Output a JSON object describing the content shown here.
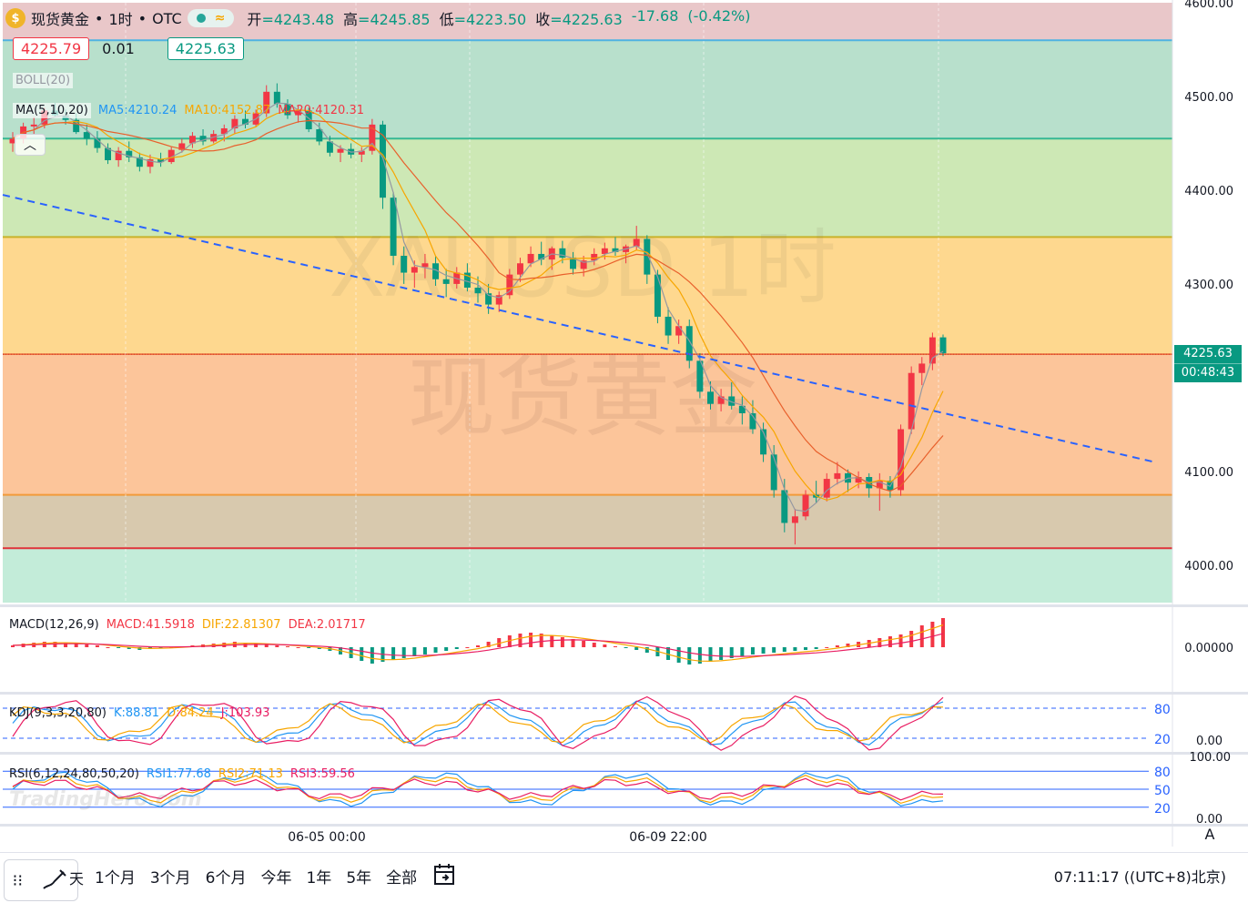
{
  "header": {
    "symbol": "现货黄金",
    "interval": "1时",
    "exchange": "OTC",
    "coin_glyph": "$",
    "wave_glyph": "≈",
    "open_label": "开",
    "open": "=4243.48",
    "high_label": "高",
    "high": "=4245.85",
    "low_label": "低",
    "low": "=4223.50",
    "close_label": "收",
    "close": "=4225.63",
    "change": "-17.68",
    "change_pct": "(-0.42%)"
  },
  "quote": {
    "sell": "4225.79",
    "spread": "0.01",
    "buy": "4225.63"
  },
  "legends": {
    "boll": "BOLL(20)",
    "ma_title": "MA(5,10,20)",
    "ma5": "MA5:4210.24",
    "ma10": "MA10:4152.87",
    "ma20": "MA20:4120.31",
    "macd_title": "MACD(12,26,9)",
    "macd": "MACD:41.5918",
    "dif": "DIF:22.81307",
    "dea": "DEA:2.01717",
    "kdj_title": "KDJ(9,3,3,20,80)",
    "k": "K:88.81",
    "d": "D:84.24",
    "j": "J:103.93",
    "rsi_title": "RSI(6,12,24,80,50,20)",
    "rsi1": "RSI1:77.68",
    "rsi2": "RSI2:71.13",
    "rsi3": "RSI3:59.56"
  },
  "watermark": {
    "line1": "XAUUSD 1时",
    "line2": "现货黄金",
    "brand": "TradingHero.com"
  },
  "price_tag": {
    "price": "4225.63",
    "countdown": "00:48:43"
  },
  "bottom": {
    "ranges": [
      "1个月",
      "3个月",
      "6个月",
      "今年",
      "1年",
      "5年",
      "全部"
    ],
    "clock": "07:11:17 ((UTC+8)北京)",
    "auto_label": "A",
    "grip_glyph": "⁝⁝",
    "cut_glyph": "天"
  },
  "colors": {
    "up": "#f23645",
    "down": "#089981",
    "ma5": "#9598a1",
    "ma10": "#f7a600",
    "ma20": "#e8602c",
    "trendline": "#2962ff",
    "macd_label": "#f23645",
    "dif": "#f7a600",
    "dea": "#e91e63",
    "k": "#2196f3",
    "d": "#f7a600",
    "j": "#e91e63"
  },
  "chart_data": {
    "type": "candlestick",
    "title": "现货黄金 · 1时 · OTC",
    "y_axis": {
      "ticks": [
        4000.0,
        4100.0,
        4200.0,
        4300.0,
        4400.0,
        4500.0,
        4600.0
      ],
      "range": [
        3960,
        4600
      ]
    },
    "x_axis": {
      "ticks": [
        "06-05 00:00",
        "06-09 22:00"
      ]
    },
    "ohlc_samples": [
      [
        4450,
        4462,
        4441,
        4455
      ],
      [
        4455,
        4472,
        4450,
        4468
      ],
      [
        4468,
        4478,
        4460,
        4470
      ],
      [
        4470,
        4488,
        4466,
        4485
      ],
      [
        4485,
        4493,
        4478,
        4480
      ],
      [
        4480,
        4486,
        4470,
        4475
      ],
      [
        4475,
        4482,
        4460,
        4462
      ],
      [
        4462,
        4470,
        4448,
        4455
      ],
      [
        4455,
        4463,
        4440,
        4445
      ],
      [
        4445,
        4450,
        4428,
        4432
      ],
      [
        4432,
        4446,
        4425,
        4442
      ],
      [
        4442,
        4452,
        4430,
        4435
      ],
      [
        4435,
        4440,
        4420,
        4425
      ],
      [
        4425,
        4438,
        4418,
        4433
      ],
      [
        4433,
        4440,
        4425,
        4430
      ],
      [
        4430,
        4446,
        4428,
        4443
      ],
      [
        4443,
        4455,
        4440,
        4450
      ],
      [
        4450,
        4462,
        4445,
        4458
      ],
      [
        4458,
        4465,
        4448,
        4452
      ],
      [
        4452,
        4464,
        4450,
        4460
      ],
      [
        4460,
        4470,
        4452,
        4466
      ],
      [
        4466,
        4480,
        4460,
        4476
      ],
      [
        4476,
        4485,
        4466,
        4470
      ],
      [
        4470,
        4486,
        4468,
        4482
      ],
      [
        4482,
        4512,
        4478,
        4505
      ],
      [
        4505,
        4514,
        4488,
        4492
      ],
      [
        4492,
        4497,
        4476,
        4480
      ],
      [
        4480,
        4490,
        4472,
        4485
      ],
      [
        4485,
        4488,
        4462,
        4465
      ],
      [
        4465,
        4472,
        4448,
        4452
      ],
      [
        4452,
        4458,
        4436,
        4440
      ],
      [
        4440,
        4448,
        4430,
        4444
      ],
      [
        4444,
        4450,
        4434,
        4438
      ],
      [
        4438,
        4446,
        4430,
        4442
      ],
      [
        4442,
        4476,
        4438,
        4470
      ],
      [
        4470,
        4474,
        4380,
        4392
      ],
      [
        4392,
        4398,
        4320,
        4330
      ],
      [
        4330,
        4340,
        4300,
        4312
      ],
      [
        4312,
        4325,
        4296,
        4318
      ],
      [
        4318,
        4332,
        4306,
        4322
      ],
      [
        4322,
        4330,
        4298,
        4305
      ],
      [
        4305,
        4316,
        4286,
        4300
      ],
      [
        4300,
        4318,
        4295,
        4312
      ],
      [
        4312,
        4322,
        4292,
        4296
      ],
      [
        4296,
        4308,
        4280,
        4290
      ],
      [
        4290,
        4300,
        4268,
        4278
      ],
      [
        4278,
        4292,
        4270,
        4288
      ],
      [
        4288,
        4316,
        4284,
        4310
      ],
      [
        4310,
        4328,
        4302,
        4322
      ],
      [
        4322,
        4340,
        4318,
        4332
      ],
      [
        4332,
        4345,
        4320,
        4326
      ],
      [
        4326,
        4340,
        4315,
        4338
      ],
      [
        4338,
        4346,
        4322,
        4328
      ],
      [
        4328,
        4334,
        4310,
        4316
      ],
      [
        4316,
        4330,
        4308,
        4325
      ],
      [
        4325,
        4338,
        4320,
        4332
      ],
      [
        4332,
        4344,
        4326,
        4338
      ],
      [
        4338,
        4350,
        4330,
        4334
      ],
      [
        4334,
        4342,
        4322,
        4340
      ],
      [
        4340,
        4362,
        4336,
        4348
      ],
      [
        4348,
        4352,
        4300,
        4310
      ],
      [
        4310,
        4315,
        4258,
        4265
      ],
      [
        4265,
        4275,
        4236,
        4245
      ],
      [
        4245,
        4262,
        4236,
        4255
      ],
      [
        4255,
        4262,
        4210,
        4218
      ],
      [
        4218,
        4226,
        4178,
        4185
      ],
      [
        4185,
        4196,
        4166,
        4172
      ],
      [
        4172,
        4188,
        4164,
        4180
      ],
      [
        4180,
        4195,
        4166,
        4170
      ],
      [
        4170,
        4180,
        4150,
        4162
      ],
      [
        4162,
        4176,
        4140,
        4145
      ],
      [
        4145,
        4152,
        4110,
        4118
      ],
      [
        4118,
        4128,
        4072,
        4080
      ],
      [
        4080,
        4092,
        4035,
        4045
      ],
      [
        4045,
        4060,
        4022,
        4052
      ],
      [
        4052,
        4080,
        4048,
        4075
      ],
      [
        4075,
        4090,
        4066,
        4072
      ],
      [
        4072,
        4098,
        4068,
        4092
      ],
      [
        4092,
        4110,
        4086,
        4098
      ],
      [
        4098,
        4102,
        4078,
        4088
      ],
      [
        4088,
        4100,
        4082,
        4094
      ],
      [
        4094,
        4098,
        4072,
        4082
      ],
      [
        4082,
        4098,
        4058,
        4090
      ],
      [
        4090,
        4095,
        4072,
        4080
      ],
      [
        4080,
        4150,
        4074,
        4145
      ],
      [
        4145,
        4212,
        4140,
        4205
      ],
      [
        4205,
        4222,
        4192,
        4215
      ],
      [
        4215,
        4248,
        4208,
        4243
      ],
      [
        4243,
        4246,
        4223,
        4226
      ]
    ],
    "bands": [
      {
        "from": 4560,
        "to": 4600,
        "label": "pink"
      },
      {
        "from": 4455,
        "to": 4560,
        "label": "mint"
      },
      {
        "from": 4350,
        "to": 4455,
        "label": "lime"
      },
      {
        "from": 4225,
        "to": 4350,
        "label": "yellow"
      },
      {
        "from": 4075,
        "to": 4225,
        "label": "orange"
      },
      {
        "from": 4018,
        "to": 4075,
        "label": "tan"
      },
      {
        "from": 3960,
        "to": 4018,
        "label": "green"
      }
    ],
    "horizontal_levels": [
      4560,
      4455,
      4350,
      4225,
      4075,
      4018
    ],
    "trendline": {
      "from": 4395,
      "to": 4110
    },
    "indicators": {
      "macd_histogram": [
        2,
        4,
        5,
        6,
        6,
        5,
        4,
        3,
        2,
        0,
        -1,
        -2,
        -3,
        -2,
        -1,
        0,
        1,
        2,
        3,
        4,
        5,
        6,
        5,
        4,
        3,
        2,
        1,
        0,
        -1,
        -2,
        -4,
        -8,
        -12,
        -15,
        -18,
        -16,
        -14,
        -12,
        -10,
        -8,
        -6,
        -4,
        -2,
        0,
        2,
        6,
        10,
        13,
        15,
        16,
        15,
        13,
        11,
        9,
        7,
        5,
        3,
        1,
        -1,
        -3,
        -6,
        -10,
        -14,
        -17,
        -19,
        -18,
        -16,
        -14,
        -12,
        -10,
        -8,
        -7,
        -6,
        -5,
        -4,
        -3,
        -2,
        0,
        2,
        4,
        6,
        8,
        10,
        12,
        14,
        18,
        24,
        28,
        32
      ],
      "kdj_levels": [
        80,
        20
      ],
      "rsi_levels": [
        80,
        50,
        20
      ],
      "kdj_axis_label": "0.00",
      "rsi_axis_top": "100.00",
      "rsi_axis_bottom": "0.00",
      "macd_axis_label": "0.00000"
    }
  }
}
